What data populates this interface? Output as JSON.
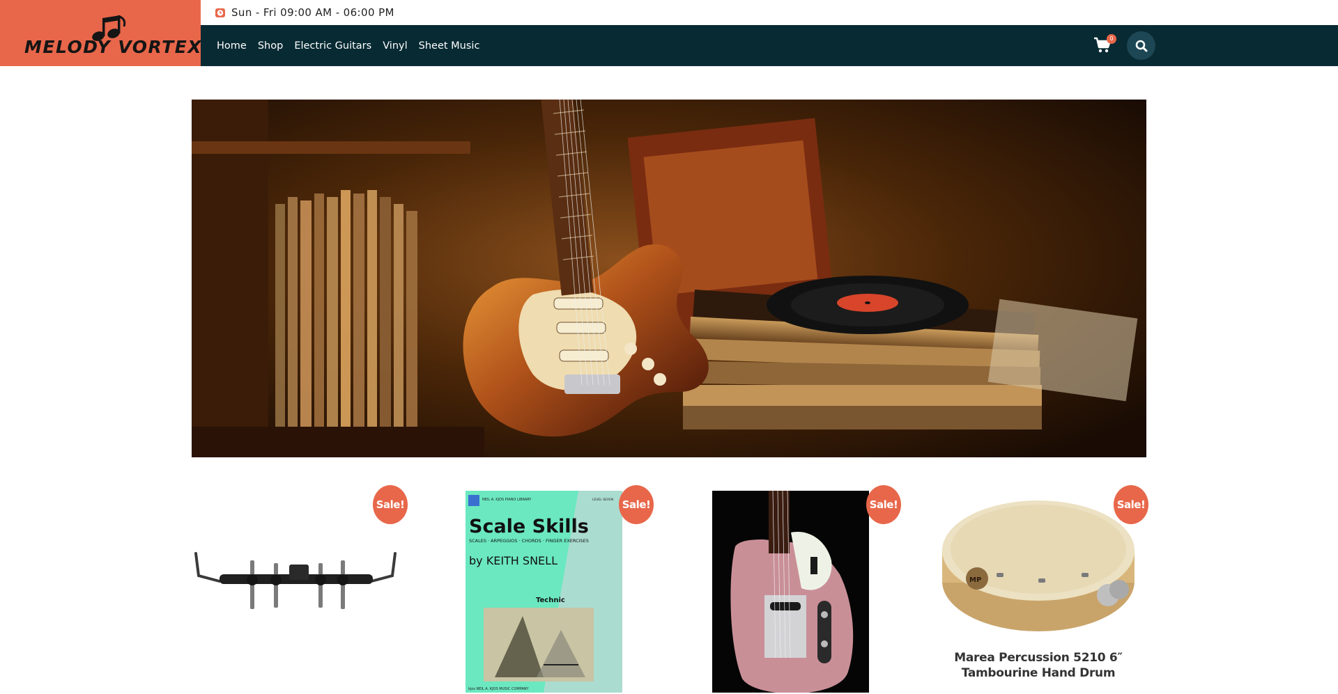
{
  "brand": {
    "name": "MELODY VORTEX",
    "logo_icon": "music-notes-icon",
    "accent_color": "#e8674a",
    "nav_color": "#082a33"
  },
  "topbar": {
    "hours_icon": "clock-icon",
    "hours": "Sun - Fri 09:00 AM - 06:00 PM"
  },
  "nav": {
    "items": [
      {
        "label": "Home"
      },
      {
        "label": "Shop"
      },
      {
        "label": "Electric Guitars"
      },
      {
        "label": "Vinyl"
      },
      {
        "label": "Sheet Music"
      }
    ]
  },
  "header_actions": {
    "cart_icon": "cart-icon",
    "cart_count": "0",
    "search_icon": "search-icon"
  },
  "hero": {
    "image": "electric guitar and vinyl records banner"
  },
  "products": [
    {
      "badge": "Sale!",
      "image": "drum hardware clamp rack",
      "title": ""
    },
    {
      "badge": "Sale!",
      "image": "Scale Skills book cover",
      "title": "",
      "cover": {
        "publisher": "NEIL A. KJOS PIANO LIBRARY",
        "level": "LEVEL SEVEN",
        "title": "Scale Skills",
        "subtitle": "SCALES · ARPEGGIOS · CHORDS · FINGER EXERCISES",
        "author": "by KEITH SNELL",
        "section": "Technic",
        "footer": "kjos NEIL A. KJOS MUSIC COMPANY"
      }
    },
    {
      "badge": "Sale!",
      "image": "pink telecaster electric guitar",
      "title": ""
    },
    {
      "badge": "Sale!",
      "image": "wooden tambourine hand drum",
      "title": "Marea Percussion 5210 6″ Tambourine Hand Drum"
    }
  ]
}
